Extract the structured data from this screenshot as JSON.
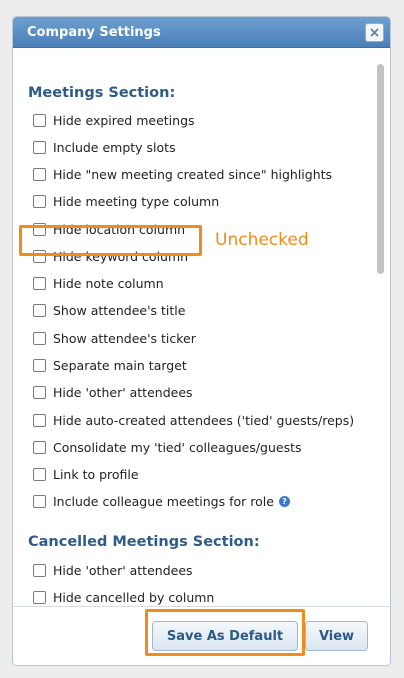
{
  "dialog": {
    "title": "Company Settings",
    "close_label": "×"
  },
  "sections": [
    {
      "title": "Meetings Section:",
      "items": [
        "Hide expired meetings",
        "Include empty slots",
        "Hide \"new meeting created since\" highlights",
        "Hide meeting type column",
        "Hide location column",
        "Hide keyword column",
        "Hide note column",
        "Show attendee's title",
        "Show attendee's ticker",
        "Separate main target",
        "Hide 'other' attendees",
        "Hide auto-created attendees ('tied' guests/reps)",
        "Consolidate my 'tied' colleagues/guests",
        "Link to profile",
        "Include colleague meetings for role"
      ]
    },
    {
      "title": "Cancelled Meetings Section:",
      "items": [
        "Hide 'other' attendees",
        "Hide cancelled by column"
      ]
    }
  ],
  "help_icon": "?",
  "annotation": {
    "text": "Unchecked",
    "color": "#f08c1a"
  },
  "footer": {
    "save_default_label": "Save As Default",
    "view_label": "View"
  }
}
